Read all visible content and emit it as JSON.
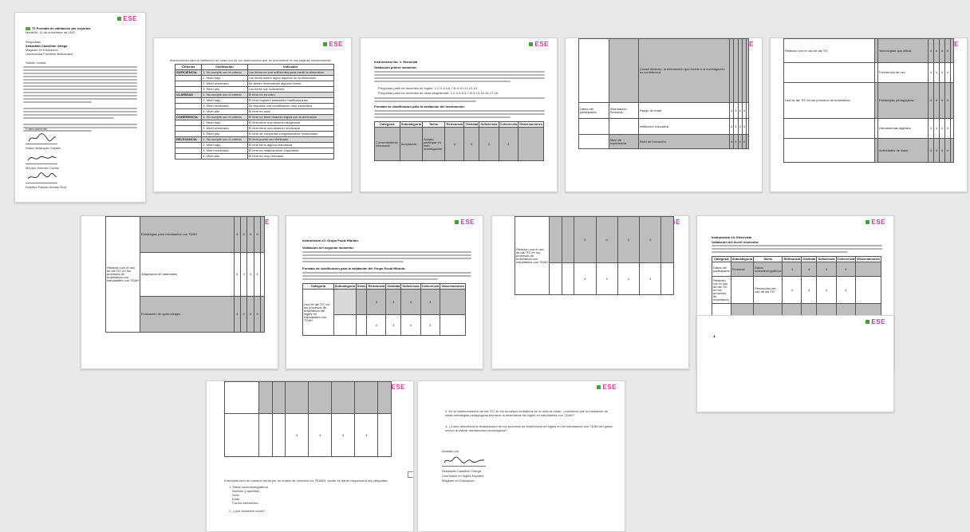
{
  "brand": {
    "logo_text": "ESE",
    "accent": "#d4359a",
    "green": "#5aa04a"
  },
  "page1": {
    "heading": "T1 Formato de validación por expertos",
    "date": "Medellín, 11 de noviembre de 2020",
    "addressee": [
      "Respetado",
      "Sebastián Castrillón Ortega",
      "Magister en Educación",
      "Universidad Pontificia Bolivariana"
    ],
    "greeting": "Saludo cordial,",
    "closing": "Fraternalmente,",
    "signers": [
      "Diana Velásquez Zapata",
      "Mónica Jiménez Cortés",
      "Estefani Palacio Arenas Ruiz"
    ]
  },
  "page2": {
    "intro": "Instrucciones para la validación de cada uno de los instrumentos que se encuentran en las páginas subsecuentes",
    "headers": [
      "Criterios",
      "Calificación",
      "Indicador"
    ],
    "rows": [
      [
        "SUFICIENCIA",
        "1. No cumple con el criterio",
        "Los ítems no son suficientes para medir la dimensión"
      ],
      [
        "",
        "2. Nivel bajo",
        "Los ítems miden algún aspecto de la dimensión"
      ],
      [
        "",
        "3. Nivel moderado",
        "Se deben incrementar algunos ítems"
      ],
      [
        "",
        "4. Nivel alto",
        "Los ítems son suficientes"
      ],
      [
        "CLARIDAD",
        "1. No cumple con el criterio",
        "El ítem no es claro"
      ],
      [
        "",
        "2. Nivel bajo",
        "El ítem requiere bastantes modificaciones"
      ],
      [
        "",
        "3. Nivel moderado",
        "Se requiere una modificación muy específica"
      ],
      [
        "",
        "4. Nivel alto",
        "El ítem es claro"
      ],
      [
        "COHERENCIA",
        "1. No cumple con el criterio",
        "El ítem no tiene relación lógica con la dimensión"
      ],
      [
        "",
        "2. Nivel bajo",
        "El ítem tiene una relación tangencial"
      ],
      [
        "",
        "3. Nivel moderado",
        "El ítem tiene una relación moderada"
      ],
      [
        "",
        "4. Nivel alto",
        "El ítem se encuentra completamente relacionado"
      ],
      [
        "RELEVANCIA",
        "1. No cumple con el criterio",
        "El ítem puede ser eliminado"
      ],
      [
        "",
        "2. Nivel bajo",
        "El ítem tiene alguna relevancia"
      ],
      [
        "",
        "3. Nivel moderado",
        "El ítem es relativamente importante"
      ],
      [
        "",
        "4. Nivel alto",
        "El ítem es muy relevante"
      ]
    ]
  },
  "page3": {
    "title": "Instrumento No. 1: Encuesta",
    "subtitle": "Validación primer momento:",
    "bullets": [
      "Preguntas para los docentes de inglés: 1-2-3-4-5-6-7-8-9-10-11-12-13.",
      "Preguntas para los docentes de otras asignaturas: 1-2-3-4-5-6-7-8-9-14-15-16-17-18."
    ],
    "format_title": "Formato de clasificación para la validación del instrumento:",
    "headers": [
      "Categoría",
      "Subcategoría",
      "Ítems",
      "Relevancia",
      "Claridad",
      "Suficiencia",
      "Coherencia",
      "Observaciones"
    ],
    "row": [
      "Consentimiento informado",
      "Aceptación",
      "Acepto participar en esta investigación",
      "4",
      "4",
      "4",
      "4",
      ""
    ]
  },
  "page4": {
    "rows": [
      [
        "",
        "",
        "Consentimiento: la información que brinde a la investigación es confidencial",
        "",
        "",
        "",
        "",
        ""
      ],
      [
        "Datos del participante",
        "Información Personal",
        "Rango de edad",
        "4",
        "4",
        "4",
        "4",
        ""
      ],
      [
        "",
        "",
        "Institución educativa",
        "4",
        "4",
        "4",
        "4",
        ""
      ],
      [
        "",
        "Nivel de experiencia",
        "Nivel de formación",
        "4",
        "4",
        "4",
        "4",
        ""
      ]
    ]
  },
  "page5": {
    "rows": [
      [
        "Relación con el uso de las TIC",
        "",
        "Tecnologías que utiliza",
        "4",
        "4",
        "4",
        "4",
        ""
      ],
      [
        "",
        "",
        "Frecuencia de uso",
        "4",
        "4",
        "4",
        "4",
        ""
      ],
      [
        "Uso de las TIC en los procesos de enseñanza",
        "",
        "Estrategias pedagógicas",
        "4",
        "4",
        "4",
        "4",
        ""
      ],
      [
        "",
        "",
        "Herramientas digitales",
        "4",
        "4",
        "4",
        "4",
        ""
      ],
      [
        "",
        "",
        "Actividades de clase",
        "4",
        "4",
        "4",
        "4",
        ""
      ]
    ]
  },
  "page6": {
    "side_label": "Relación con el uso de las TIC en los procesos de enseñanza con estudiantes con TDAH",
    "rows": [
      [
        "Estrategias para estudiantes con TDAH",
        "4",
        "4",
        "4",
        "4"
      ],
      [
        "Adaptación de materiales",
        "4",
        "4",
        "4",
        "4"
      ],
      [
        "Evaluación de aprendizajes",
        "4",
        "4",
        "4",
        "4"
      ]
    ]
  },
  "page7": {
    "title": "Instrumento #2: Grupo Focal Híbrido.",
    "subtitle": "Validación del segundo momento:",
    "format_title": "Formato de clasificación para la validación del Grupo Focal Híbrido:",
    "headers": [
      "Categoría",
      "Subcategoría",
      "Ítems",
      "Relevancia",
      "Claridad",
      "Suficiencia",
      "Coherencia",
      "Observaciones"
    ],
    "row_label": "Uso de las TIC en los procesos de enseñanza del inglés en estudiantes con TDAH",
    "scores": [
      "4",
      "4",
      "4",
      "4"
    ]
  },
  "page8": {
    "side_label": "Relación con el uso de las TIC en los procesos de enseñanza con estudiantes con TDAH",
    "scores": [
      "4",
      "4",
      "4",
      "4"
    ]
  },
  "page9": {
    "title": "Instrumento #3: Entrevista",
    "subtitle": "Validación del tercer momento:",
    "headers": [
      "Categoría",
      "Subcategoría",
      "Ítems",
      "Relevancia",
      "Claridad",
      "Suficiencia",
      "Coherencia",
      "Observaciones"
    ],
    "rows": [
      [
        "Datos del participante",
        "Personal",
        "Datos sociodemográficos",
        "4",
        "4",
        "4",
        "4"
      ],
      [
        "Relación con el uso de las TIC en los procesos de enseñanza",
        "",
        "Percepción del uso de las TIC",
        "4",
        "4",
        "4",
        "4"
      ],
      [
        "",
        "",
        "Estrategias pedagógicas",
        "4",
        "4",
        "4",
        "4"
      ]
    ]
  },
  "page10": {
    "mark": "1"
  },
  "page11": {
    "scores": [
      "4",
      "4",
      "4",
      "4"
    ],
    "intro": "Entrevista será de manera virtual por un enlace de conexión en TEAMS, donde se darán respuesta a las preguntas:",
    "list": [
      "1. Datos sociodemográficos",
      "Nombre y apellidos",
      "Sexo",
      "Edad",
      "Correo electrónico",
      "2. ¿Qué semestre cursa?"
    ]
  },
  "page12": {
    "questions": [
      "3. En la implementación de las TIC en los procesos formativos en el aula de clase, ¿considera que la mediación de estas estrategias pedagógicas favorece la enseñanza del inglés en estudiantes con TDAH?",
      "4. ¿Cómo describiría la dinamización de los procesos de enseñanza del inglés en los estudiantes con TDAH del grado octavo al utilizar mediaciones tecnológicas?"
    ],
    "validated_by": "Avalado por",
    "signer": "Sebastián Castrillón Ortega",
    "signer_role": "Licenciado en Inglés-Español",
    "signer_degree": "Magister en Educación"
  }
}
